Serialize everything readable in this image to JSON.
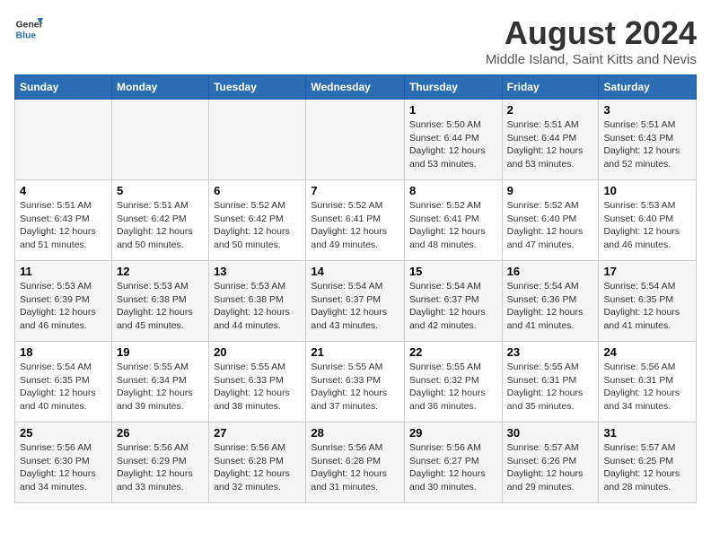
{
  "header": {
    "logo_line1": "General",
    "logo_line2": "Blue",
    "month_year": "August 2024",
    "location": "Middle Island, Saint Kitts and Nevis"
  },
  "weekdays": [
    "Sunday",
    "Monday",
    "Tuesday",
    "Wednesday",
    "Thursday",
    "Friday",
    "Saturday"
  ],
  "weeks": [
    [
      {
        "day": "",
        "info": ""
      },
      {
        "day": "",
        "info": ""
      },
      {
        "day": "",
        "info": ""
      },
      {
        "day": "",
        "info": ""
      },
      {
        "day": "1",
        "info": "Sunrise: 5:50 AM\nSunset: 6:44 PM\nDaylight: 12 hours\nand 53 minutes."
      },
      {
        "day": "2",
        "info": "Sunrise: 5:51 AM\nSunset: 6:44 PM\nDaylight: 12 hours\nand 53 minutes."
      },
      {
        "day": "3",
        "info": "Sunrise: 5:51 AM\nSunset: 6:43 PM\nDaylight: 12 hours\nand 52 minutes."
      }
    ],
    [
      {
        "day": "4",
        "info": "Sunrise: 5:51 AM\nSunset: 6:43 PM\nDaylight: 12 hours\nand 51 minutes."
      },
      {
        "day": "5",
        "info": "Sunrise: 5:51 AM\nSunset: 6:42 PM\nDaylight: 12 hours\nand 50 minutes."
      },
      {
        "day": "6",
        "info": "Sunrise: 5:52 AM\nSunset: 6:42 PM\nDaylight: 12 hours\nand 50 minutes."
      },
      {
        "day": "7",
        "info": "Sunrise: 5:52 AM\nSunset: 6:41 PM\nDaylight: 12 hours\nand 49 minutes."
      },
      {
        "day": "8",
        "info": "Sunrise: 5:52 AM\nSunset: 6:41 PM\nDaylight: 12 hours\nand 48 minutes."
      },
      {
        "day": "9",
        "info": "Sunrise: 5:52 AM\nSunset: 6:40 PM\nDaylight: 12 hours\nand 47 minutes."
      },
      {
        "day": "10",
        "info": "Sunrise: 5:53 AM\nSunset: 6:40 PM\nDaylight: 12 hours\nand 46 minutes."
      }
    ],
    [
      {
        "day": "11",
        "info": "Sunrise: 5:53 AM\nSunset: 6:39 PM\nDaylight: 12 hours\nand 46 minutes."
      },
      {
        "day": "12",
        "info": "Sunrise: 5:53 AM\nSunset: 6:38 PM\nDaylight: 12 hours\nand 45 minutes."
      },
      {
        "day": "13",
        "info": "Sunrise: 5:53 AM\nSunset: 6:38 PM\nDaylight: 12 hours\nand 44 minutes."
      },
      {
        "day": "14",
        "info": "Sunrise: 5:54 AM\nSunset: 6:37 PM\nDaylight: 12 hours\nand 43 minutes."
      },
      {
        "day": "15",
        "info": "Sunrise: 5:54 AM\nSunset: 6:37 PM\nDaylight: 12 hours\nand 42 minutes."
      },
      {
        "day": "16",
        "info": "Sunrise: 5:54 AM\nSunset: 6:36 PM\nDaylight: 12 hours\nand 41 minutes."
      },
      {
        "day": "17",
        "info": "Sunrise: 5:54 AM\nSunset: 6:35 PM\nDaylight: 12 hours\nand 41 minutes."
      }
    ],
    [
      {
        "day": "18",
        "info": "Sunrise: 5:54 AM\nSunset: 6:35 PM\nDaylight: 12 hours\nand 40 minutes."
      },
      {
        "day": "19",
        "info": "Sunrise: 5:55 AM\nSunset: 6:34 PM\nDaylight: 12 hours\nand 39 minutes."
      },
      {
        "day": "20",
        "info": "Sunrise: 5:55 AM\nSunset: 6:33 PM\nDaylight: 12 hours\nand 38 minutes."
      },
      {
        "day": "21",
        "info": "Sunrise: 5:55 AM\nSunset: 6:33 PM\nDaylight: 12 hours\nand 37 minutes."
      },
      {
        "day": "22",
        "info": "Sunrise: 5:55 AM\nSunset: 6:32 PM\nDaylight: 12 hours\nand 36 minutes."
      },
      {
        "day": "23",
        "info": "Sunrise: 5:55 AM\nSunset: 6:31 PM\nDaylight: 12 hours\nand 35 minutes."
      },
      {
        "day": "24",
        "info": "Sunrise: 5:56 AM\nSunset: 6:31 PM\nDaylight: 12 hours\nand 34 minutes."
      }
    ],
    [
      {
        "day": "25",
        "info": "Sunrise: 5:56 AM\nSunset: 6:30 PM\nDaylight: 12 hours\nand 34 minutes."
      },
      {
        "day": "26",
        "info": "Sunrise: 5:56 AM\nSunset: 6:29 PM\nDaylight: 12 hours\nand 33 minutes."
      },
      {
        "day": "27",
        "info": "Sunrise: 5:56 AM\nSunset: 6:28 PM\nDaylight: 12 hours\nand 32 minutes."
      },
      {
        "day": "28",
        "info": "Sunrise: 5:56 AM\nSunset: 6:28 PM\nDaylight: 12 hours\nand 31 minutes."
      },
      {
        "day": "29",
        "info": "Sunrise: 5:56 AM\nSunset: 6:27 PM\nDaylight: 12 hours\nand 30 minutes."
      },
      {
        "day": "30",
        "info": "Sunrise: 5:57 AM\nSunset: 6:26 PM\nDaylight: 12 hours\nand 29 minutes."
      },
      {
        "day": "31",
        "info": "Sunrise: 5:57 AM\nSunset: 6:25 PM\nDaylight: 12 hours\nand 28 minutes."
      }
    ]
  ]
}
